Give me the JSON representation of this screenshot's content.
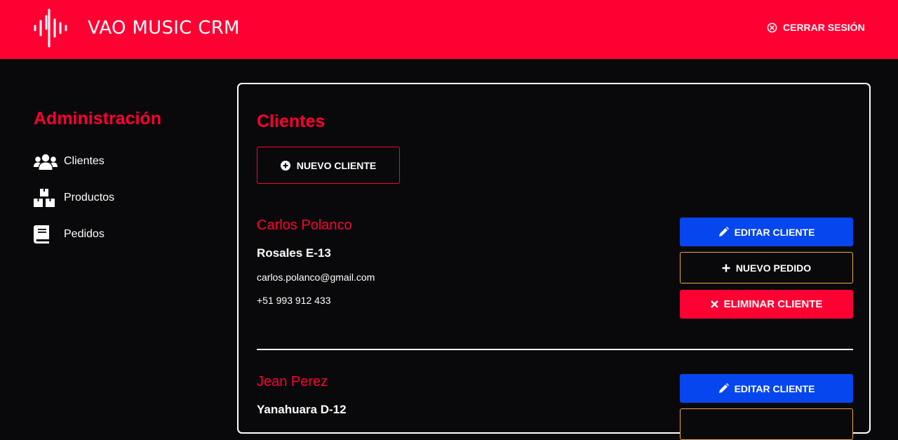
{
  "header": {
    "brand": "VAO MUSIC CRM",
    "logout_label": "CERRAR SESIÓN",
    "background_color": "#ff0033"
  },
  "sidebar": {
    "title": "Administración",
    "items": [
      {
        "label": "Clientes",
        "icon": "users-icon"
      },
      {
        "label": "Productos",
        "icon": "boxes-icon"
      },
      {
        "label": "Pedidos",
        "icon": "book-icon"
      }
    ]
  },
  "main": {
    "title": "Clientes",
    "new_client_label": "NUEVO CLIENTE",
    "clients": [
      {
        "name": "Carlos Polanco",
        "address": "Rosales E-13",
        "email": "carlos.polanco@gmail.com",
        "phone": "+51 993 912 433",
        "edit_label": "EDITAR CLIENTE",
        "new_order_label": "NUEVO PEDIDO",
        "delete_label": "ELIMINAR CLIENTE"
      },
      {
        "name": "Jean Perez",
        "address": "Yanahuara D-12",
        "edit_label": "EDITAR CLIENTE"
      }
    ]
  },
  "colors": {
    "accent": "#ff0033",
    "edit_button": "#0646ee",
    "order_button_border": "#f0a64a",
    "background": "#09090b"
  }
}
